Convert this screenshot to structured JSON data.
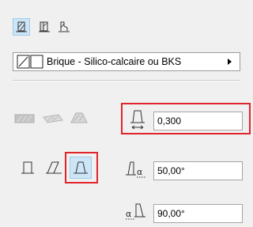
{
  "material": {
    "label": "Brique - Silico-calcaire ou BKS"
  },
  "fields": {
    "thickness": "0,300",
    "angle_top": "50,00°",
    "angle_bottom": "90,00°"
  },
  "colors": {
    "highlight": "#e0242b",
    "selected_bg": "#cde6f7"
  }
}
